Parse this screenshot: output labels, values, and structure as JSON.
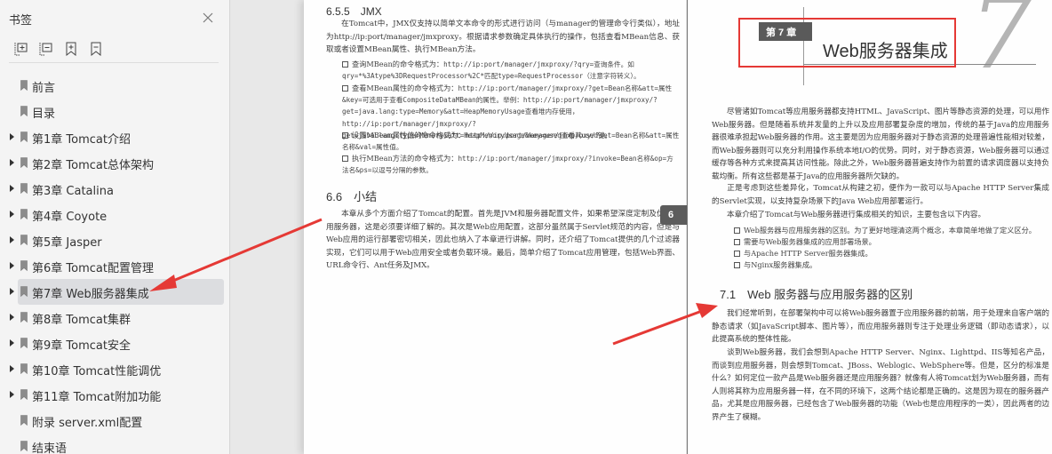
{
  "sidebar": {
    "title": "书签",
    "tools": [
      {
        "name": "expand-all-icon",
        "label": "展开全部"
      },
      {
        "name": "collapse-all-icon",
        "label": "折叠全部"
      },
      {
        "name": "add-bookmark-icon",
        "label": "添加书签"
      },
      {
        "name": "remove-bookmark-icon",
        "label": "删除书签"
      }
    ],
    "items": [
      {
        "label": "前言",
        "expandable": false,
        "active": false
      },
      {
        "label": "目录",
        "expandable": false,
        "active": false
      },
      {
        "label": "第1章 Tomcat介绍",
        "expandable": true,
        "active": false
      },
      {
        "label": "第2章 Tomcat总体架构",
        "expandable": true,
        "active": false
      },
      {
        "label": "第3章 Catalina",
        "expandable": true,
        "active": false
      },
      {
        "label": "第4章 Coyote",
        "expandable": true,
        "active": false
      },
      {
        "label": "第5章 Jasper",
        "expandable": true,
        "active": false
      },
      {
        "label": "第6章 Tomcat配置管理",
        "expandable": true,
        "active": false
      },
      {
        "label": "第7章 Web服务器集成",
        "expandable": true,
        "active": true
      },
      {
        "label": "第8章 Tomcat集群",
        "expandable": true,
        "active": false
      },
      {
        "label": "第9章 Tomcat安全",
        "expandable": true,
        "active": false
      },
      {
        "label": "第10章 Tomcat性能调优",
        "expandable": true,
        "active": false
      },
      {
        "label": "第11章 Tomcat附加功能",
        "expandable": true,
        "active": false
      },
      {
        "label": "附录 server.xml配置",
        "expandable": false,
        "active": false
      },
      {
        "label": "结束语",
        "expandable": false,
        "active": false
      }
    ]
  },
  "left_page": {
    "section_655": {
      "heading": "6.5.5　JMX",
      "intro": "在Tomcat中，JMX仅支持以简单文本命令的形式进行访问（与manager的管理命令行类似），地址为http://ip:port/manager/jmxproxy。根据请求参数确定具体执行的操作，包括查看MBean信息、获取或者设置MBean属性、执行MBean方法。",
      "bullets": [
        {
          "text": "查询MBean的命令格式为：",
          "code": "http://ip:port/manager/jmxproxy/?qry=查询条件。如qry=*%3Atype%3DRequestProcessor%2C*匹配type=RequestProcessor（注意字符转义）。"
        },
        {
          "text": "查看MBean属性的命令格式为：",
          "code": "http://ip:port/manager/jmxproxy/?get=Bean名称&att=属性&key=可选用于查看CompositeDataMBean的属性。举例：http://ip:port/manager/jmxproxy/?get=java.lang:type=Memory&att=HeapMemoryUsage查看堆内存使用，http://ip:port/manager/jmxproxy/?get=java.lang:type=Memory&att=HeapMemoryUsage&key=used查看其used键。"
        },
        {
          "text": "设置MBean属性值的命令格式为：",
          "code": "http://ip:port/manager/jmxproxy/?set=Bean名称&att=属性名称&val=属性值。"
        },
        {
          "text": "执行MBean方法的命令格式为：",
          "code": "http://ip:port/manager/jmxproxy/?invoke=Bean名称&op=方法名&ps=以逗号分隔的参数。"
        }
      ]
    },
    "section_66": {
      "heading": "6.6　小结",
      "body": "本章从多个方面介绍了Tomcat的配置。首先是JVM和服务器配置文件，如果希望深度定制及优化应用服务器，这是必须要详细了解的。其次是Web应用配置，这部分虽然属于Servlet规范的内容，但是与Web应用的运行部署密切相关，因此也纳入了本章进行讲解。同时，还介绍了Tomcat提供的几个过滤器实现，它们可以用于Web应用安全或者负载环境。最后，简单介绍了Tomcat应用管理，包括Web界面、URL命令行、Ant任务及JMX。"
    },
    "chapter_tab": "6"
  },
  "right_page": {
    "chapter_badge": "第 7 章",
    "chapter_title": "Web服务器集成",
    "chapter_number": "7",
    "p1": "尽管诸如Tomcat等应用服务器都支持HTML、JavaScript、图片等静态资源的处理，可以用作Web服务器。但是随着系统并发量的上升以及应用部署复杂度的增加，传统的基于Java的应用服务器很难承担起Web服务器的作用。这主要是因为应用服务器对于静态资源的处理普遍性能相对较差，而Web服务器则可以充分利用操作系统本地I/O的优势。同时，对于静态资源，Web服务器可以通过缓存等各种方式来提高其访问性能。除此之外，Web服务器普遍支持作为前置的请求调度器以支持负载均衡。所有这些都是基于Java的应用服务器所欠缺的。",
    "p2": "正是考虑到这些差异化，Tomcat从构建之初，便作为一款可以与Apache HTTP Server集成的Servlet实现，以支持复杂场景下的Java Web应用部署运行。",
    "p3": "本章介绍了Tomcat与Web服务器进行集成相关的知识，主要包含以下内容。",
    "bullets": [
      "Web服务器与应用服务器的区别。为了更好地理清这两个概念，本章简单地做了定义区分。",
      "需要与Web服务器集成的应用部署场景。",
      "与Apache HTTP Server服务器集成。",
      "与Nginx服务器集成。"
    ],
    "section_71": {
      "heading": "7.1　Web 服务器与应用服务器的区别",
      "p1": "我们经常听到，在部署架构中可以将Web服务器置于应用服务器的前端，用于处理来自客户端的静态请求（如JavaScript脚本、图片等），而应用服务器则专注于处理业务逻辑（即动态请求），以此提高系统的整体性能。",
      "p2": "谈到Web服务器，我们会想到Apache HTTP Server、Nginx、Lighttpd、IIS等知名产品，而谈到应用服务器，则会想到Tomcat、JBoss、Weblogic、WebSphere等。但是，区分的标准是什么？如何定位一款产品是Web服务器还是应用服务器？就像有人将Tomcat划为Web服务器，而有人则将其称为应用服务器一样，在不同的环境下，这两个结论都是正确的。这是因为现在的服务器产品，尤其是应用服务器，已经包含了Web服务器的功能（Web也是应用程序的一类），因此两者的边界产生了模糊。"
    }
  },
  "annotations": {
    "arrow_color": "#e53935",
    "box_color": "#e53935"
  }
}
